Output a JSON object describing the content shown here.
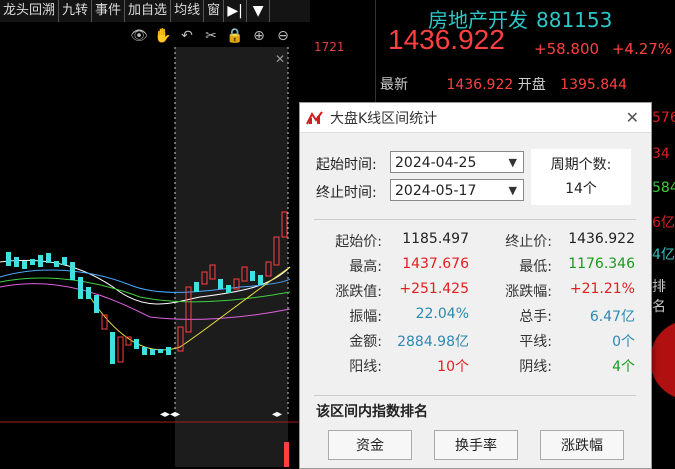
{
  "tabs": [
    "龙头回溯",
    "九转",
    "事件",
    "加自选",
    "均线",
    "窗"
  ],
  "chart": {
    "axis_value": "1721"
  },
  "stock": {
    "name": "房地产开发",
    "code": "881153",
    "price": "1436.922",
    "change": "+58.800",
    "change_pct": "+4.27%",
    "latest_label": "最新",
    "latest_value": "1436.922",
    "open_label": "开盘",
    "open_value": "1395.844",
    "side_values": [
      "576",
      "34",
      "584",
      "6亿",
      "4亿",
      "排名"
    ]
  },
  "dialog": {
    "title": "大盘K线区间统计",
    "start_label": "起始时间:",
    "start_value": "2024-04-25",
    "end_label": "终止时间:",
    "end_value": "2024-05-17",
    "period_label": "周期个数:",
    "period_value": "14个",
    "stats": [
      {
        "l1": "起始价:",
        "v1": "1185.497",
        "c1": "black",
        "l2": "终止价:",
        "v2": "1436.922",
        "c2": "black"
      },
      {
        "l1": "最高:",
        "v1": "1437.676",
        "c1": "red",
        "l2": "最低:",
        "v2": "1176.346",
        "c2": "green"
      },
      {
        "l1": "涨跌值:",
        "v1": "+251.425",
        "c1": "red",
        "l2": "涨跌幅:",
        "v2": "+21.21%",
        "c2": "red"
      },
      {
        "l1": "振幅:",
        "v1": "22.04%",
        "c1": "blue",
        "l2": "总手:",
        "v2": "6.47亿",
        "c2": "blue"
      },
      {
        "l1": "金额:",
        "v1": "2884.98亿",
        "c1": "blue",
        "l2": "平线:",
        "v2": "0个",
        "c2": "blue"
      },
      {
        "l1": "阳线:",
        "v1": "10个",
        "c1": "red",
        "l2": "阴线:",
        "v2": "4个",
        "c2": "green"
      }
    ],
    "rank_title": "该区间内指数排名",
    "buttons": [
      "资金",
      "换手率",
      "涨跌幅"
    ]
  }
}
